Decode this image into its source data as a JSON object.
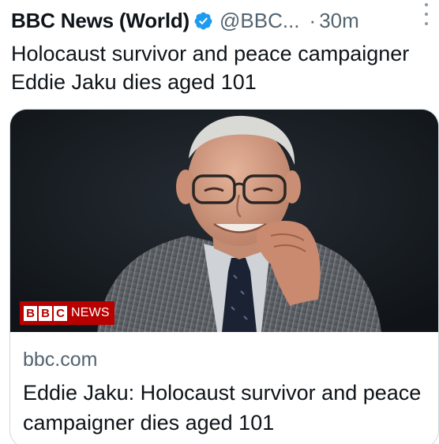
{
  "tweet": {
    "author_name": "BBC News (World)",
    "handle": "@BBC...",
    "separator": "·",
    "time": "30m",
    "text": "Holocaust survivor and peace campaigner Eddie Jaku dies aged 101",
    "verified_icon": "verified-badge-icon",
    "more_icon": "more-vertical-icon"
  },
  "card": {
    "badge_letters": [
      "B",
      "B",
      "C"
    ],
    "badge_label": "NEWS",
    "domain": "bbc.com",
    "title": "Eddie Jaku: Holocaust survivor and peace campaigner dies aged 101"
  },
  "colors": {
    "verified_blue": "#1d9bf0",
    "bbc_red": "#b80000",
    "secondary_text": "#536471"
  }
}
